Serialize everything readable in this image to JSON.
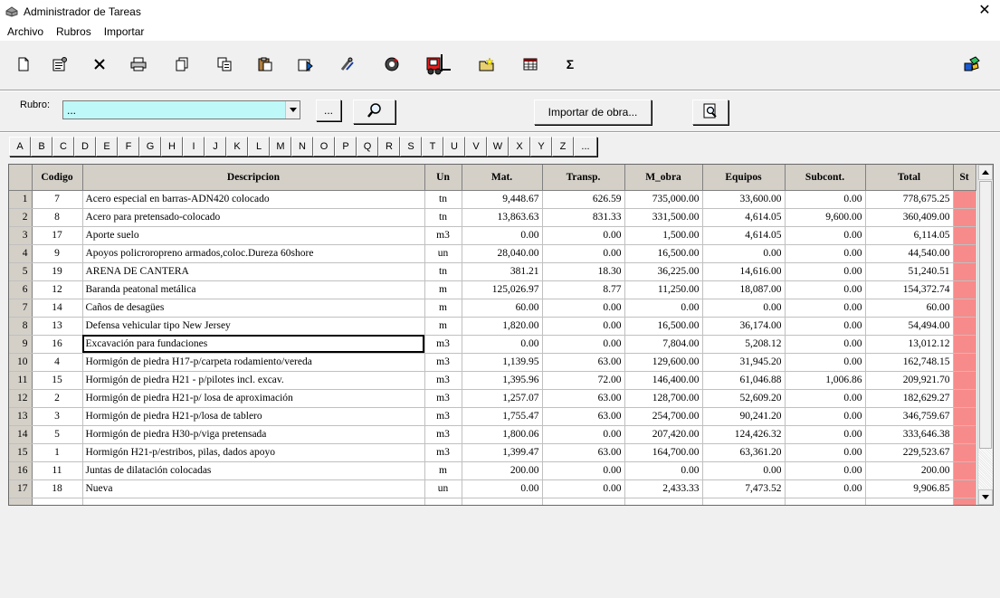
{
  "window": {
    "title": "Administrador de Tareas",
    "close_glyph": "✕"
  },
  "menu": [
    {
      "label": "Archivo"
    },
    {
      "label": "Rubros"
    },
    {
      "label": "Importar"
    }
  ],
  "toolbar": {
    "icons": [
      "new-icon",
      "properties-icon",
      "delete-icon",
      "print-icon",
      "copy-icon",
      "duplicate-icon",
      "paste-icon",
      "export-icon",
      "tools-icon",
      "refresh-icon",
      "forklift-icon",
      "new-folder-icon",
      "table-icon",
      "sigma-icon",
      "app-logo-icon"
    ],
    "sigma_glyph": "Σ"
  },
  "rubro": {
    "label": "Rubro:",
    "value": "...",
    "browse_label": "...",
    "import_label": "Importar de obra..."
  },
  "alphabet": [
    "A",
    "B",
    "C",
    "D",
    "E",
    "F",
    "G",
    "H",
    "I",
    "J",
    "K",
    "L",
    "M",
    "N",
    "O",
    "P",
    "Q",
    "R",
    "S",
    "T",
    "U",
    "V",
    "W",
    "X",
    "Y",
    "Z",
    "..."
  ],
  "grid": {
    "columns": [
      "Codigo",
      "Descripcion",
      "Un",
      "Mat.",
      "Transp.",
      "M_obra",
      "Equipos",
      "Subcont.",
      "Total",
      "St"
    ],
    "rows": [
      {
        "n": "1",
        "codigo": "7",
        "desc": "Acero especial en barras-ADN420 colocado",
        "un": "tn",
        "mat": "9,448.67",
        "transp": "626.59",
        "mobra": "735,000.00",
        "equipos": "33,600.00",
        "subcont": "0.00",
        "total": "778,675.25"
      },
      {
        "n": "2",
        "codigo": "8",
        "desc": "Acero para pretensado-colocado",
        "un": "tn",
        "mat": "13,863.63",
        "transp": "831.33",
        "mobra": "331,500.00",
        "equipos": "4,614.05",
        "subcont": "9,600.00",
        "total": "360,409.00"
      },
      {
        "n": "3",
        "codigo": "17",
        "desc": "Aporte suelo",
        "un": "m3",
        "mat": "0.00",
        "transp": "0.00",
        "mobra": "1,500.00",
        "equipos": "4,614.05",
        "subcont": "0.00",
        "total": "6,114.05"
      },
      {
        "n": "4",
        "codigo": "9",
        "desc": "Apoyos policroropreno armados,coloc.Dureza 60shore",
        "un": "un",
        "mat": "28,040.00",
        "transp": "0.00",
        "mobra": "16,500.00",
        "equipos": "0.00",
        "subcont": "0.00",
        "total": "44,540.00"
      },
      {
        "n": "5",
        "codigo": "19",
        "desc": "ARENA DE CANTERA",
        "un": "tn",
        "mat": "381.21",
        "transp": "18.30",
        "mobra": "36,225.00",
        "equipos": "14,616.00",
        "subcont": "0.00",
        "total": "51,240.51"
      },
      {
        "n": "6",
        "codigo": "12",
        "desc": "Baranda peatonal metálica",
        "un": "m",
        "mat": "125,026.97",
        "transp": "8.77",
        "mobra": "11,250.00",
        "equipos": "18,087.00",
        "subcont": "0.00",
        "total": "154,372.74"
      },
      {
        "n": "7",
        "codigo": "14",
        "desc": "Caños de desagües",
        "un": "m",
        "mat": "60.00",
        "transp": "0.00",
        "mobra": "0.00",
        "equipos": "0.00",
        "subcont": "0.00",
        "total": "60.00"
      },
      {
        "n": "8",
        "codigo": "13",
        "desc": "Defensa vehicular tipo New Jersey",
        "un": "m",
        "mat": "1,820.00",
        "transp": "0.00",
        "mobra": "16,500.00",
        "equipos": "36,174.00",
        "subcont": "0.00",
        "total": "54,494.00"
      },
      {
        "n": "9",
        "codigo": "16",
        "desc": "Excavación para fundaciones",
        "un": "m3",
        "mat": "0.00",
        "transp": "0.00",
        "mobra": "7,804.00",
        "equipos": "5,208.12",
        "subcont": "0.00",
        "total": "13,012.12"
      },
      {
        "n": "10",
        "codigo": "4",
        "desc": "Hormigón de piedra H17-p/carpeta rodamiento/vereda",
        "un": "m3",
        "mat": "1,139.95",
        "transp": "63.00",
        "mobra": "129,600.00",
        "equipos": "31,945.20",
        "subcont": "0.00",
        "total": "162,748.15"
      },
      {
        "n": "11",
        "codigo": "15",
        "desc": "Hormigón de piedra H21 - p/pilotes incl. excav.",
        "un": "m3",
        "mat": "1,395.96",
        "transp": "72.00",
        "mobra": "146,400.00",
        "equipos": "61,046.88",
        "subcont": "1,006.86",
        "total": "209,921.70"
      },
      {
        "n": "12",
        "codigo": "2",
        "desc": "Hormigón de piedra H21-p/ losa de aproximación",
        "un": "m3",
        "mat": "1,257.07",
        "transp": "63.00",
        "mobra": "128,700.00",
        "equipos": "52,609.20",
        "subcont": "0.00",
        "total": "182,629.27"
      },
      {
        "n": "13",
        "codigo": "3",
        "desc": "Hormigón de piedra H21-p/losa de tablero",
        "un": "m3",
        "mat": "1,755.47",
        "transp": "63.00",
        "mobra": "254,700.00",
        "equipos": "90,241.20",
        "subcont": "0.00",
        "total": "346,759.67"
      },
      {
        "n": "14",
        "codigo": "5",
        "desc": "Hormigón de piedra H30-p/viga pretensada",
        "un": "m3",
        "mat": "1,800.06",
        "transp": "0.00",
        "mobra": "207,420.00",
        "equipos": "124,426.32",
        "subcont": "0.00",
        "total": "333,646.38"
      },
      {
        "n": "15",
        "codigo": "1",
        "desc": "Hormigón H21-p/estribos, pilas, dados apoyo",
        "un": "m3",
        "mat": "1,399.47",
        "transp": "63.00",
        "mobra": "164,700.00",
        "equipos": "63,361.20",
        "subcont": "0.00",
        "total": "229,523.67"
      },
      {
        "n": "16",
        "codigo": "11",
        "desc": "Juntas de dilatación colocadas",
        "un": "m",
        "mat": "200.00",
        "transp": "0.00",
        "mobra": "0.00",
        "equipos": "0.00",
        "subcont": "0.00",
        "total": "200.00"
      },
      {
        "n": "17",
        "codigo": "18",
        "desc": "Nueva",
        "un": "un",
        "mat": "0.00",
        "transp": "0.00",
        "mobra": "2,433.33",
        "equipos": "7,473.52",
        "subcont": "0.00",
        "total": "9,906.85"
      }
    ],
    "selected_row": "9",
    "st_color": "#f78b8b"
  }
}
